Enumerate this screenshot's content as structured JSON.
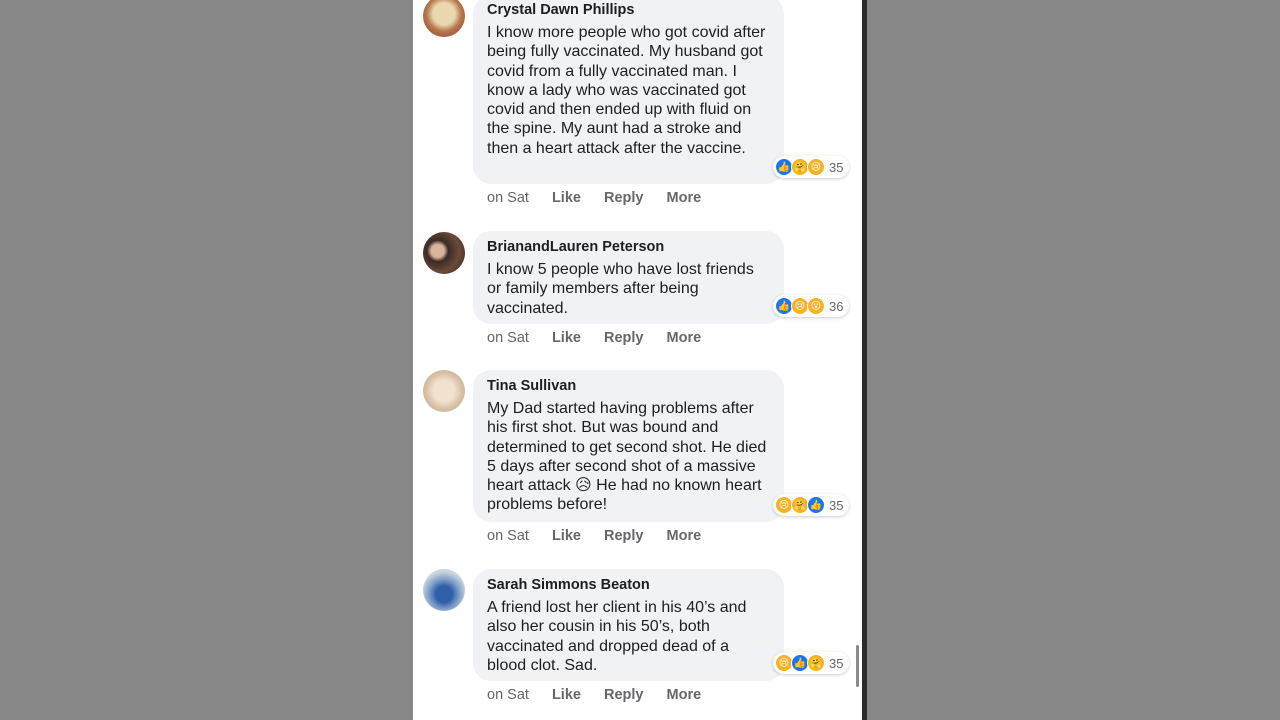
{
  "comments": [
    {
      "author": "Crystal Dawn Phillips",
      "text": "I know more people who got covid after being fully vaccinated. My husband got covid from a fully vaccinated man. I know a lady who was vaccinated got covid and then ended up with fluid on the spine. My aunt had a stroke and then a heart attack after the vaccine.",
      "time": "on Sat",
      "like": "Like",
      "reply": "Reply",
      "more": "More",
      "reaction_icons": [
        "like-icon",
        "care-icon",
        "sad-icon"
      ],
      "reaction_count": "35"
    },
    {
      "author": "BrianandLauren Peterson",
      "text": "I know 5 people who have lost friends or family members after being vaccinated.",
      "time": "on Sat",
      "like": "Like",
      "reply": "Reply",
      "more": "More",
      "reaction_icons": [
        "like-icon",
        "sad-icon",
        "wow-icon"
      ],
      "reaction_count": "36"
    },
    {
      "author": "Tina Sullivan",
      "text": "My Dad started having problems after his first shot. But was bound and determined to get second shot. He died 5 days after second shot of a massive heart attack 😥 He had no known heart problems before!",
      "time": "on Sat",
      "like": "Like",
      "reply": "Reply",
      "more": "More",
      "reaction_icons": [
        "sad-icon",
        "care-icon",
        "like-icon"
      ],
      "reaction_count": "35"
    },
    {
      "author": "Sarah Simmons Beaton",
      "text": "A friend lost her client in his 40’s and also her cousin in his 50’s, both vaccinated and dropped dead of a blood clot. Sad.",
      "time": "on Sat",
      "like": "Like",
      "reply": "Reply",
      "more": "More",
      "reaction_icons": [
        "sad-icon",
        "like-icon",
        "care-icon"
      ],
      "reaction_count": "35"
    }
  ],
  "colors": {
    "bubble": "#f0f2f5",
    "like_blue": "#1877f2",
    "reaction_yellow": "#f7b125",
    "meta_gray": "#65676b"
  }
}
